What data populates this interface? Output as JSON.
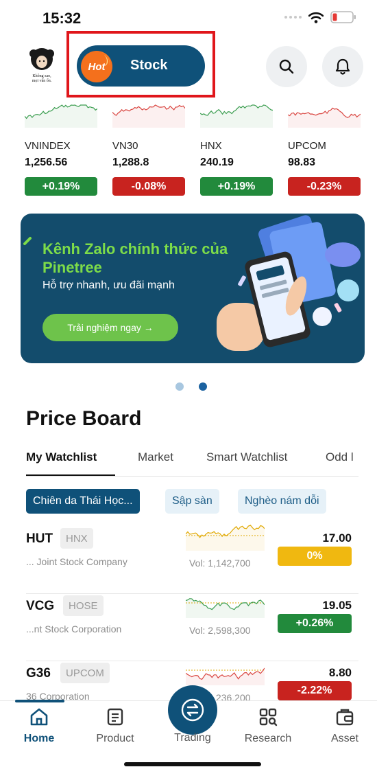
{
  "status_bar": {
    "time": "15:32"
  },
  "header": {
    "avatar_caption": "Không sao, mọi vấn ổn.",
    "hot_label": "Hot",
    "stock_button_label": "Stock"
  },
  "indices": [
    {
      "name": "VNINDEX",
      "value": "1,256.56",
      "change": "+0.19%",
      "trend": "up"
    },
    {
      "name": "VN30",
      "value": "1,288.8",
      "change": "-0.08%",
      "trend": "down"
    },
    {
      "name": "HNX",
      "value": "240.19",
      "change": "+0.19%",
      "trend": "up"
    },
    {
      "name": "UPCOM",
      "value": "98.83",
      "change": "-0.23%",
      "trend": "down"
    }
  ],
  "banner": {
    "title": "Kênh Zalo chính thức của Pinetree",
    "subtitle": "Hỗ trợ nhanh, ưu đãi mạnh",
    "cta": "Trải nghiệm ngay →",
    "active_slide": 2,
    "slide_count": 2
  },
  "price_board": {
    "title": "Price Board",
    "tabs": [
      "My Watchlist",
      "Market",
      "Smart Watchlist",
      "Odd l"
    ],
    "active_tab": 0,
    "chips": [
      "Chiên da Thái Học...",
      "Sập sàn",
      "Nghèo nám dỗi"
    ],
    "active_chip": 0,
    "rows": [
      {
        "symbol": "HUT",
        "exchange": "HNX",
        "company": "... Joint Stock Company",
        "vol": "Vol:  1,142,700",
        "price": "17.00",
        "change": "0%",
        "trend": "flat"
      },
      {
        "symbol": "VCG",
        "exchange": "HOSE",
        "company": "...nt Stock Corporation",
        "vol": "Vol:  2,598,300",
        "price": "19.05",
        "change": "+0.26%",
        "trend": "up"
      },
      {
        "symbol": "G36",
        "exchange": "UPCOM",
        "company": "36 Corporation",
        "vol": "Vol:  1,236,200",
        "price": "8.80",
        "change": "-2.22%",
        "trend": "down"
      }
    ]
  },
  "bottom_nav": {
    "items": [
      "Home",
      "Product",
      "Trading",
      "Research",
      "Asset"
    ],
    "active": 0
  },
  "colors": {
    "brand": "#0f5179",
    "up": "#228a3c",
    "down": "#c8231f",
    "reference": "#f0b810",
    "banner_bg": "#134c6c",
    "banner_accent": "#7ddc49"
  }
}
